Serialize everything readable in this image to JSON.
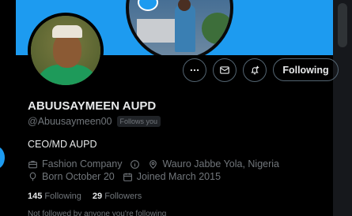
{
  "profile": {
    "name": "ABUUSAYMEEN AUPD",
    "handle": "@Abuusaymeen00",
    "follows_you": "Follows you",
    "bio": "CEO/MD AUPD",
    "category": "Fashion Company",
    "location": "Wauro Jabbe Yola, Nigeria",
    "born": "Born October 20",
    "joined": "Joined March 2015",
    "following_count": "145",
    "following_label": "Following",
    "followers_count": "29",
    "followers_label": "Followers",
    "mutual_text": "Not followed by anyone you're following"
  },
  "actions": {
    "more_icon": "more-icon",
    "message_icon": "mail-icon",
    "notify_icon": "bell-plus-icon",
    "follow_label": "Following"
  },
  "colors": {
    "accent": "#1d9bf0",
    "background": "#000000",
    "muted_text": "#71767b",
    "primary_text": "#e7e9ea"
  }
}
